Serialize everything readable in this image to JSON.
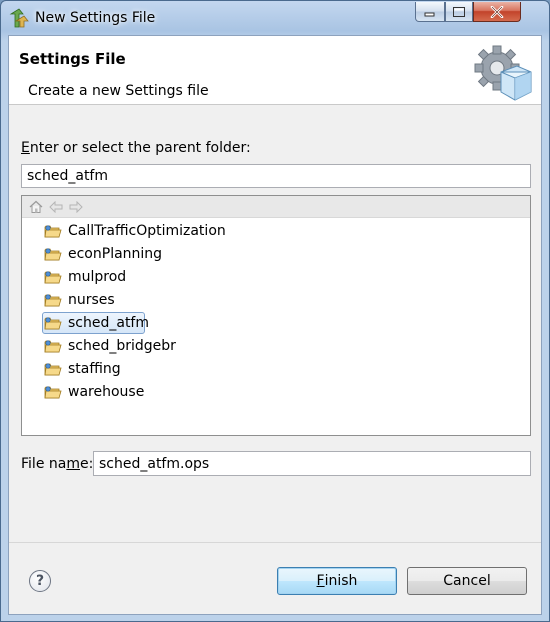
{
  "window": {
    "title": "New Settings File"
  },
  "header": {
    "title": "Settings File",
    "description": "Create a new Settings file",
    "graphic_icon": "settings-gear-cube-icon"
  },
  "parent_folder": {
    "label_prefix": "",
    "label_accel": "E",
    "label_rest": "nter or select the parent folder:",
    "value": "sched_atfm"
  },
  "tree": {
    "toolbar": {
      "home_icon": "home-icon",
      "back_icon": "back-arrow-icon",
      "forward_icon": "forward-arrow-icon"
    },
    "items": [
      {
        "label": "CallTrafficOptimization",
        "selected": false
      },
      {
        "label": "econPlanning",
        "selected": false
      },
      {
        "label": "mulprod",
        "selected": false
      },
      {
        "label": "nurses",
        "selected": false
      },
      {
        "label": "sched_atfm",
        "selected": true
      },
      {
        "label": "sched_bridgebr",
        "selected": false
      },
      {
        "label": "staffing",
        "selected": false
      },
      {
        "label": "warehouse",
        "selected": false
      }
    ]
  },
  "file_name": {
    "label_prefix": "File na",
    "label_accel": "m",
    "label_rest": "e:",
    "value": "sched_atfm.ops"
  },
  "buttons": {
    "help": "?",
    "finish_accel": "F",
    "finish_rest": "inish",
    "cancel": "Cancel"
  },
  "colors": {
    "selection_border": "#7da2ce",
    "default_button_border": "#3c7fb1",
    "close_button": "#c2432a"
  }
}
